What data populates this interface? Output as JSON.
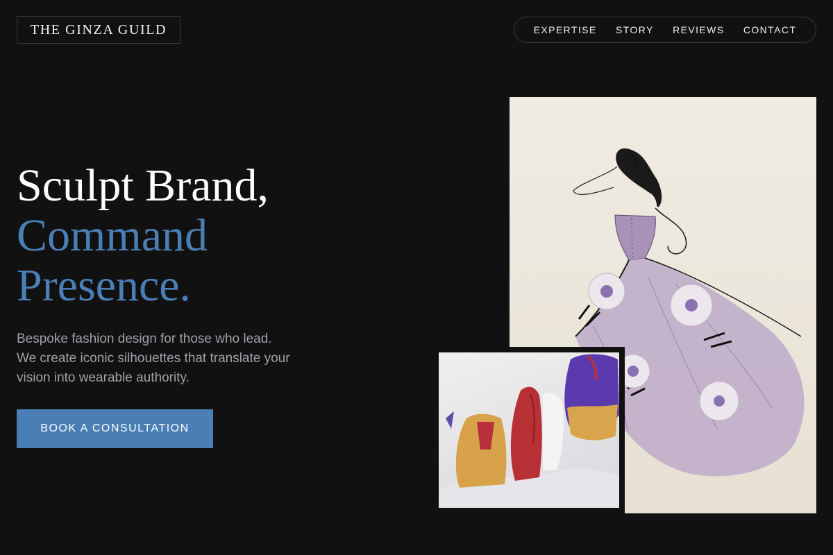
{
  "brand": {
    "name": "THE GINZA GUILD"
  },
  "nav": {
    "items": [
      {
        "label": "EXPERTISE"
      },
      {
        "label": "STORY"
      },
      {
        "label": "REVIEWS"
      },
      {
        "label": "CONTACT"
      }
    ]
  },
  "hero": {
    "title_line1": "Sculpt Brand,",
    "title_line2": "Command",
    "title_line3": "Presence.",
    "description_lines": [
      "Bespoke fashion design for those who lead.",
      "We create iconic silhouettes that translate your",
      "vision into wearable authority."
    ],
    "cta_label": "BOOK A CONSULTATION"
  },
  "images": {
    "sketch": "watercolor-gown-illustration",
    "photo": "hanging-jackets-photo"
  },
  "colors": {
    "background": "#111112",
    "accent": "#4a7fb5",
    "text_muted": "#9ea3a8"
  }
}
